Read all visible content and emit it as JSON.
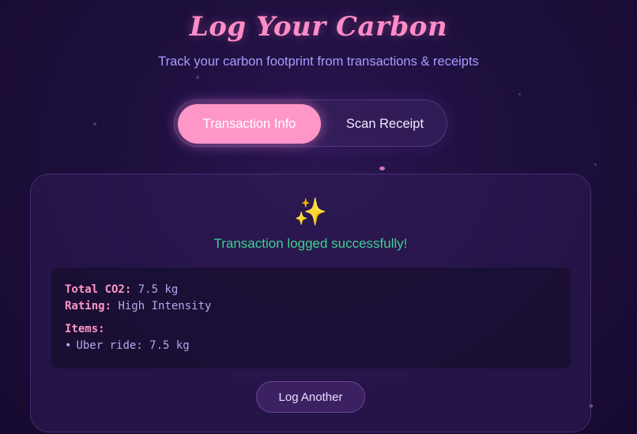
{
  "header": {
    "title": "Log Your Carbon",
    "subtitle": "Track your carbon footprint from transactions & receipts"
  },
  "tabs": [
    {
      "label": "Transaction Info",
      "active": true
    },
    {
      "label": "Scan Receipt",
      "active": false
    }
  ],
  "result_card": {
    "icon": "sparkles-icon",
    "icon_glyph": "✨",
    "status_message": "Transaction logged successfully!",
    "total_label": "Total CO2:",
    "total_value": "7.5 kg",
    "rating_label": "Rating:",
    "rating_value": "High Intensity",
    "items_label": "Items:",
    "items": [
      {
        "text": "Uber ride: 7.5 kg"
      }
    ],
    "log_another_label": "Log Another"
  },
  "colors": {
    "accent_pink": "#ff96c8",
    "success_green": "#3fd08f",
    "subtitle_purple": "#a99bff",
    "background": "#1d0f3d"
  }
}
